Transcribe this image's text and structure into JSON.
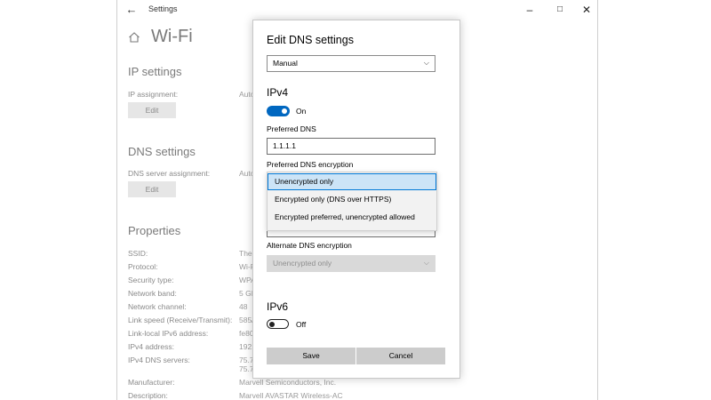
{
  "window": {
    "title": "Settings",
    "back_icon": "back-arrow-icon",
    "controls": {
      "minimize": "–",
      "maximize": "□",
      "close": "✕"
    }
  },
  "page": {
    "title": "Wi-Fi",
    "home_icon": "home-icon"
  },
  "ip_settings": {
    "heading": "IP settings",
    "assignment_label": "IP assignment:",
    "assignment_value": "Auto",
    "edit_label": "Edit"
  },
  "dns_settings": {
    "heading": "DNS settings",
    "assignment_label": "DNS server assignment:",
    "assignment_value": "Auto",
    "edit_label": "Edit"
  },
  "properties": {
    "heading": "Properties",
    "rows": [
      {
        "label": "SSID:",
        "value": "The"
      },
      {
        "label": "Protocol:",
        "value": "Wi-F"
      },
      {
        "label": "Security type:",
        "value": "WPA"
      },
      {
        "label": "Network band:",
        "value": "5 GH"
      },
      {
        "label": "Network channel:",
        "value": "48"
      },
      {
        "label": "Link speed (Receive/Transmit):",
        "value": "585/"
      },
      {
        "label": "Link-local IPv6 address:",
        "value": "fe80"
      },
      {
        "label": "IPv4 address:",
        "value": "192."
      },
      {
        "label": "IPv4 DNS servers:",
        "value": "75.75"
      },
      {
        "label": "",
        "value": "75.75"
      },
      {
        "label": "Manufacturer:",
        "value": "Marvell Semiconductors, Inc."
      },
      {
        "label": "Description:",
        "value": "Marvell AVASTAR Wireless-AC"
      }
    ]
  },
  "dialog": {
    "title": "Edit DNS settings",
    "mode_select": {
      "value": "Manual"
    },
    "ipv4": {
      "heading": "IPv4",
      "toggle_state": "On",
      "preferred_dns_label": "Preferred DNS",
      "preferred_dns_value": "1.1.1.1",
      "preferred_encryption_label": "Preferred DNS encryption",
      "encryption_options": [
        "Unencrypted only",
        "Encrypted only (DNS over HTTPS)",
        "Encrypted preferred, unencrypted allowed"
      ],
      "alternate_encryption_label": "Alternate DNS encryption",
      "alternate_encryption_value": "Unencrypted only"
    },
    "ipv6": {
      "heading": "IPv6",
      "toggle_state": "Off"
    },
    "save_label": "Save",
    "cancel_label": "Cancel"
  },
  "colors": {
    "accent": "#0067c0",
    "selection": "#cce4f7",
    "button": "#cccccc"
  }
}
